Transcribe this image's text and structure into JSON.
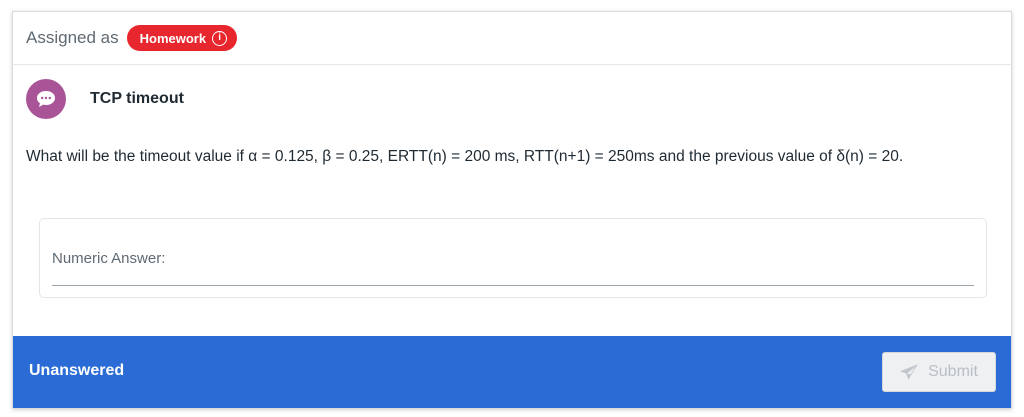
{
  "assignment": {
    "label": "Assigned as",
    "badge": "Homework",
    "badge_icon": "info-icon",
    "badge_color": "#e8262e"
  },
  "question": {
    "avatar_icon": "speech-bubble-icon",
    "avatar_color": "#a95497",
    "title": "TCP timeout",
    "text": "What will be the timeout value if α = 0.125, β = 0.25, ERTT(n) = 200 ms, RTT(n+1) = 250ms and the previous value of δ(n) = 20."
  },
  "answer": {
    "placeholder": "Numeric Answer:",
    "value": ""
  },
  "footer": {
    "status": "Unanswered",
    "submit_label": "Submit",
    "submit_icon": "paper-plane-icon",
    "background_color": "#2a6bd5"
  }
}
